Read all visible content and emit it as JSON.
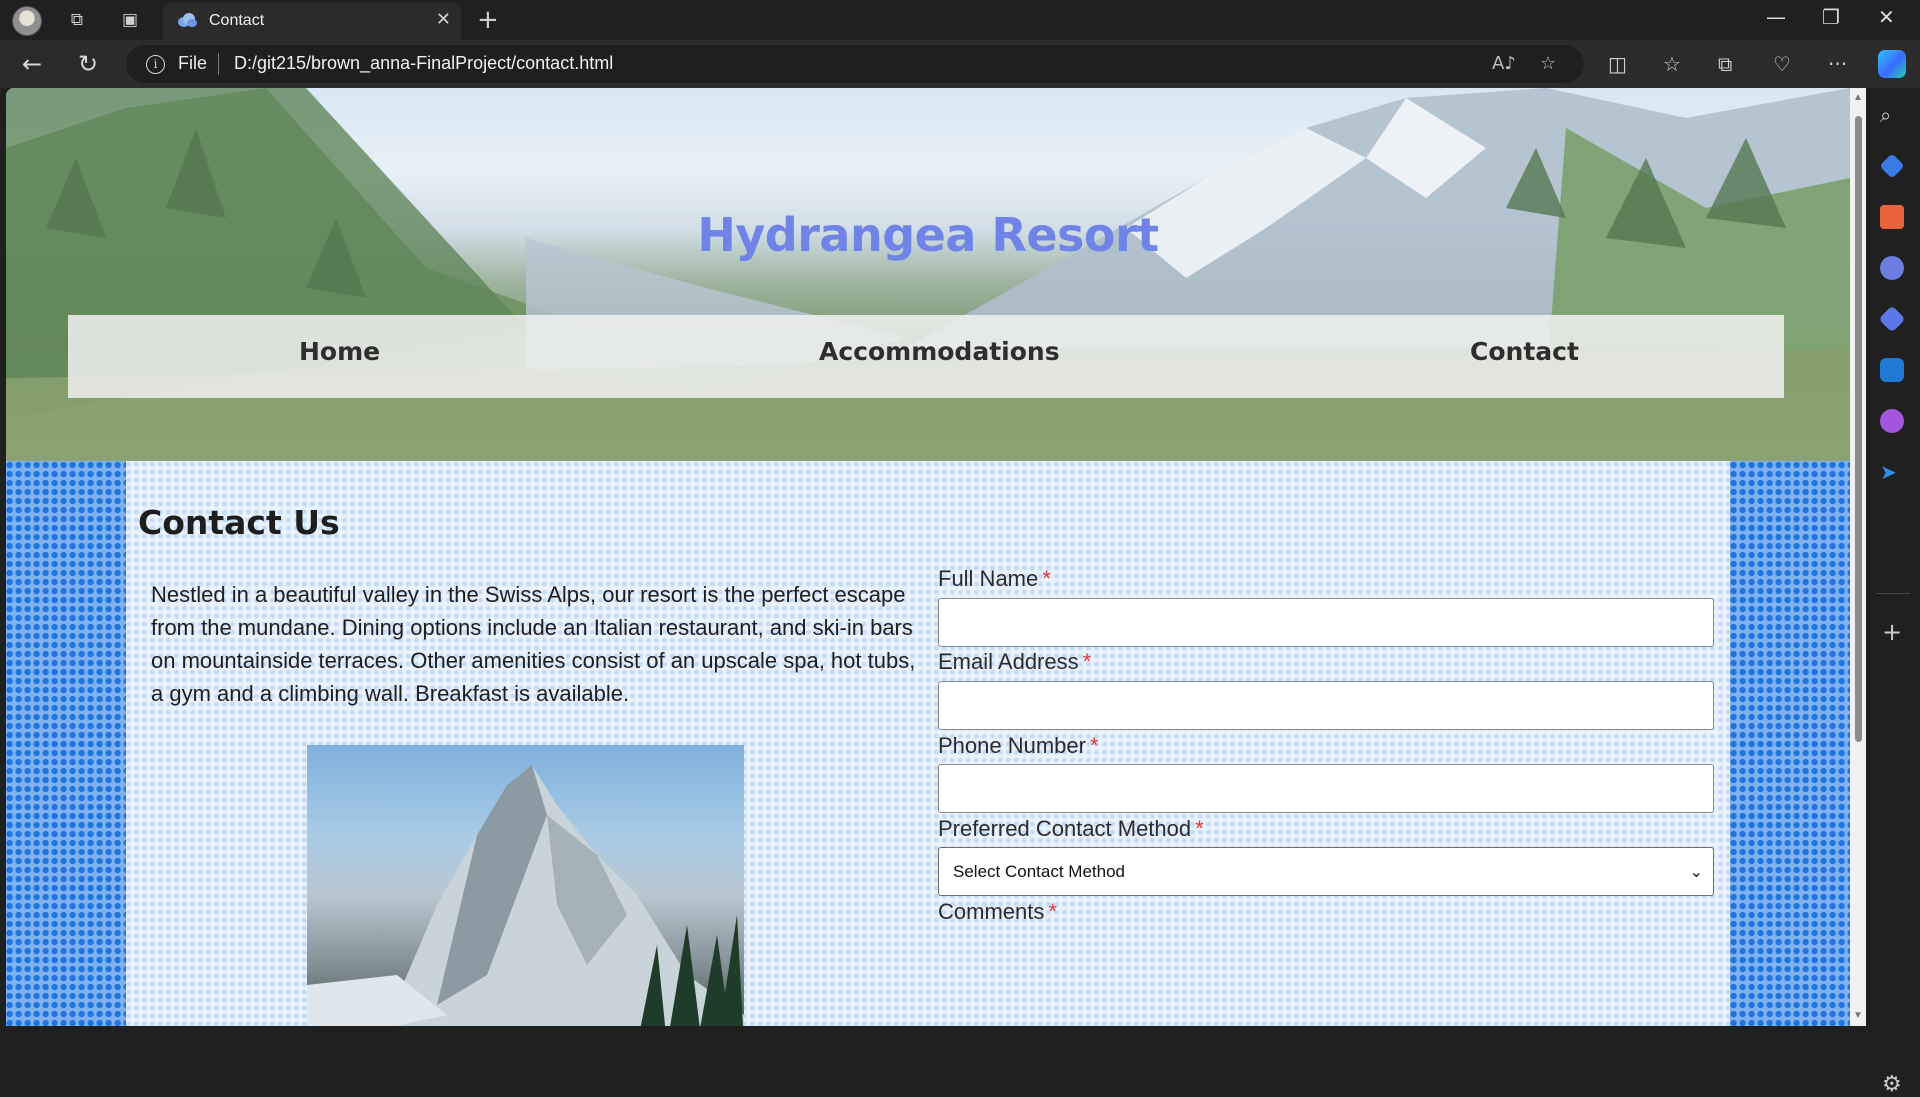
{
  "browser": {
    "tab_title": "Contact",
    "address_scheme": "File",
    "url": "D:/git215/brown_anna-FinalProject/contact.html"
  },
  "site": {
    "title": "Hydrangea Resort",
    "nav": [
      "Home",
      "Accommodations",
      "Contact"
    ]
  },
  "page": {
    "heading": "Contact Us",
    "intro": "Nestled in a beautiful valley in the Swiss Alps, our resort is the perfect escape from the mundane. Dining options include an Italian restaurant, and ski-in bars on mountainside terraces. Other amenities consist of an upscale spa, hot tubs, a gym and a climbing wall. Breakfast is available."
  },
  "form": {
    "full_name_label": "Full Name",
    "email_label": "Email Address",
    "phone_label": "Phone Number",
    "method_label": "Preferred Contact Method",
    "method_selected": "Select Contact Method",
    "comments_label": "Comments",
    "required_mark": "*"
  },
  "colors": {
    "title": "#6f84e6",
    "required": "#e03a3a",
    "pattern_side": "#1f74e0",
    "pattern_main": "#c7dcf5"
  }
}
